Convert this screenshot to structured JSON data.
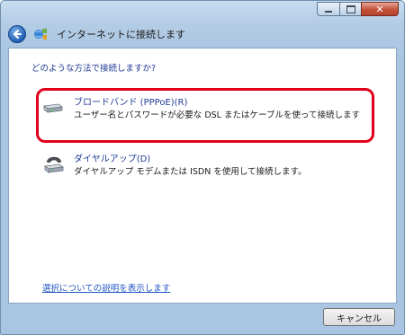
{
  "window": {
    "title": "インターネットに接続します",
    "controls": {
      "minimize": "minimize-icon",
      "maximize": "maximize-icon",
      "close": "close-icon"
    }
  },
  "main": {
    "question": "どのような方法で接続しますか?",
    "options": [
      {
        "title": "ブロードバンド (PPPoE)(R)",
        "description": "ユーザー名とパスワードが必要な DSL またはケーブルを使って接続します",
        "icon": "broadband-modem-icon",
        "highlighted": true
      },
      {
        "title": "ダイヤルアップ(D)",
        "description": "ダイヤルアップ モデムまたは ISDN を使用して接続します。",
        "icon": "dialup-modem-icon",
        "highlighted": false
      }
    ],
    "help_link": "選択についての説明を表示します"
  },
  "footer": {
    "cancel_label": "キャンセル"
  },
  "colors": {
    "highlight": "#e0001b",
    "link": "#1f56c4",
    "heading": "#1f3a93"
  }
}
